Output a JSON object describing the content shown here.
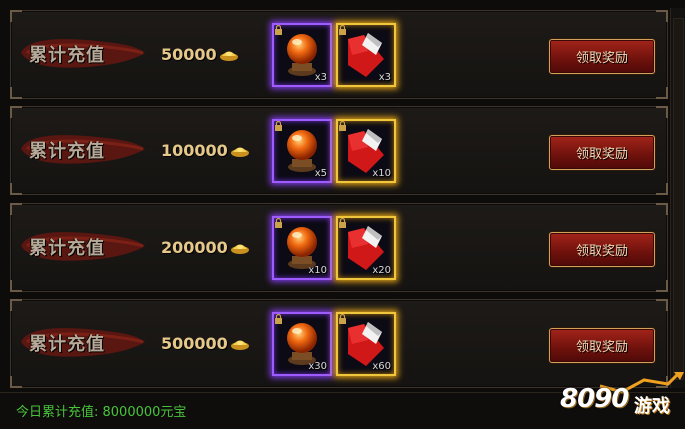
{
  "rows": [
    {
      "label": "累计充值",
      "amount": "50000",
      "items": [
        {
          "type": "orb",
          "qty": "x3"
        },
        {
          "type": "banner",
          "qty": "x3"
        }
      ],
      "button": "领取奖励"
    },
    {
      "label": "累计充值",
      "amount": "100000",
      "items": [
        {
          "type": "orb",
          "qty": "x5"
        },
        {
          "type": "banner",
          "qty": "x10"
        }
      ],
      "button": "领取奖励"
    },
    {
      "label": "累计充值",
      "amount": "200000",
      "items": [
        {
          "type": "orb",
          "qty": "x10"
        },
        {
          "type": "banner",
          "qty": "x20"
        }
      ],
      "button": "领取奖励"
    },
    {
      "label": "累计充值",
      "amount": "500000",
      "items": [
        {
          "type": "orb",
          "qty": "x30"
        },
        {
          "type": "banner",
          "qty": "x60"
        }
      ],
      "button": "领取奖励"
    }
  ],
  "footer": {
    "today_total": "今日累计充值: 8000000元宝"
  },
  "watermark": {
    "number": "8090",
    "text": "游戏"
  },
  "colors": {
    "accent_gold": "#e6c88a",
    "status_green": "#49c33c",
    "button_red": "#8e1a12",
    "purple_frame": "#9e5cff",
    "gold_frame": "#f0c63c"
  },
  "icons": {
    "currency": "gold-ingot-icon",
    "item1": "orange-orb-icon",
    "item2": "red-banner-icon",
    "lock": "lock-icon"
  }
}
